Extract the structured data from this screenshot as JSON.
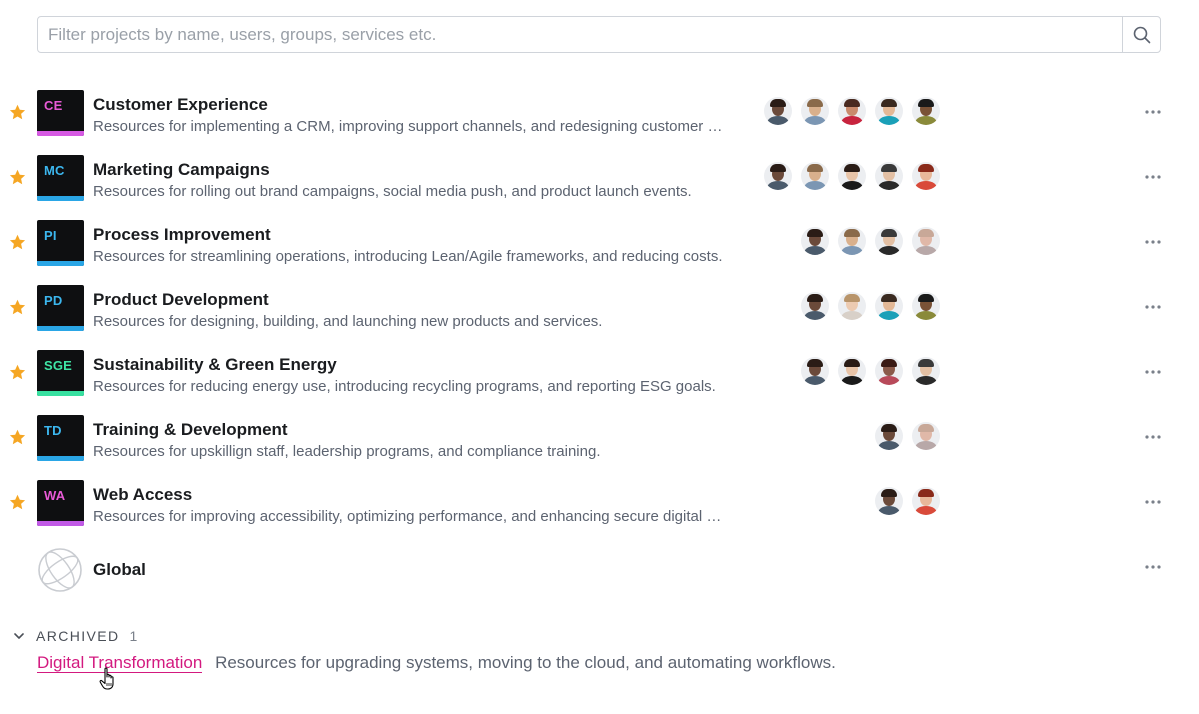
{
  "search": {
    "placeholder": "Filter projects by name, users, groups, services etc."
  },
  "projects": [
    {
      "abbr": "CE",
      "abbr_color": "#e85ad6",
      "stripe": "#d65ae3",
      "title": "Customer Experience",
      "desc": "Resources for implementing a CRM, improving support channels, and redesigning customer to...",
      "starred": true,
      "avatars": [
        {
          "skin": "#6b4a3a",
          "hair": "#2a1c16",
          "shirt": "#4a5a6b"
        },
        {
          "skin": "#d9b08c",
          "hair": "#8a6a4a",
          "shirt": "#7b96b3"
        },
        {
          "skin": "#c98a6c",
          "hair": "#4a2a20",
          "shirt": "#c8243e"
        },
        {
          "skin": "#e3b896",
          "hair": "#3a2a20",
          "shirt": "#1aa0b8"
        },
        {
          "skin": "#7a5236",
          "hair": "#1a1a1a",
          "shirt": "#8a8a3a"
        }
      ]
    },
    {
      "abbr": "MC",
      "abbr_color": "#3cb7ef",
      "stripe": "#2aa6e6",
      "title": "Marketing Campaigns",
      "desc": "Resources for rolling out brand campaigns, social media push, and product launch events.",
      "starred": true,
      "avatars": [
        {
          "skin": "#6b4a3a",
          "hair": "#2a1c16",
          "shirt": "#4a5a6b"
        },
        {
          "skin": "#d9b08c",
          "hair": "#8a6a4a",
          "shirt": "#7b96b3"
        },
        {
          "skin": "#e8c4a8",
          "hair": "#2a1c16",
          "shirt": "#1a1a1a"
        },
        {
          "skin": "#e3c0a4",
          "hair": "#3a3a3a",
          "shirt": "#2a2a2a"
        },
        {
          "skin": "#e8b89a",
          "hair": "#8a2a1a",
          "shirt": "#d94a3a"
        }
      ]
    },
    {
      "abbr": "PI",
      "abbr_color": "#3cb7ef",
      "stripe": "#2aa6e6",
      "title": "Process Improvement",
      "desc": "Resources for streamlining operations, introducing Lean/Agile frameworks, and reducing costs.",
      "starred": true,
      "avatars": [
        {
          "skin": "#6b4a3a",
          "hair": "#2a1c16",
          "shirt": "#4a5a6b"
        },
        {
          "skin": "#d9b08c",
          "hair": "#8a6a4a",
          "shirt": "#7b96b3"
        },
        {
          "skin": "#e3c0a4",
          "hair": "#3a3a3a",
          "shirt": "#2a2a2a"
        },
        {
          "skin": "#e0b8a8",
          "hair": "#c8a898",
          "shirt": "#b8a8a8"
        }
      ]
    },
    {
      "abbr": "PD",
      "abbr_color": "#3cb7ef",
      "stripe": "#2aa6e6",
      "title": "Product Development",
      "desc": "Resources for designing, building, and launching new products and services.",
      "starred": true,
      "avatars": [
        {
          "skin": "#6b4a3a",
          "hair": "#2a1c16",
          "shirt": "#4a5a6b"
        },
        {
          "skin": "#eccab0",
          "hair": "#b8946a",
          "shirt": "#d8d0c8"
        },
        {
          "skin": "#e3b896",
          "hair": "#3a2a20",
          "shirt": "#1aa0b8"
        },
        {
          "skin": "#7a5236",
          "hair": "#1a1a1a",
          "shirt": "#8a8a3a"
        }
      ]
    },
    {
      "abbr": "SGE",
      "abbr_color": "#3ee6a6",
      "stripe": "#38e0a0",
      "title": "Sustainability & Green Energy",
      "desc": "Resources for reducing energy use, introducing recycling programs, and reporting ESG goals.",
      "starred": true,
      "avatars": [
        {
          "skin": "#6b4a3a",
          "hair": "#2a1c16",
          "shirt": "#4a5a6b"
        },
        {
          "skin": "#e8c4a8",
          "hair": "#2a1c16",
          "shirt": "#1a1a1a"
        },
        {
          "skin": "#8a5a4a",
          "hair": "#3a1a14",
          "shirt": "#b84a5a"
        },
        {
          "skin": "#e3c0a4",
          "hair": "#3a3a3a",
          "shirt": "#2a2a2a"
        }
      ]
    },
    {
      "abbr": "TD",
      "abbr_color": "#3cb7ef",
      "stripe": "#2aa6e6",
      "title": "Training & Development",
      "desc": "Resources for upskillign staff, leadership programs, and compliance training.",
      "starred": true,
      "avatars": [
        {
          "skin": "#6b4a3a",
          "hair": "#2a1c16",
          "shirt": "#4a5a6b"
        },
        {
          "skin": "#e0b8a8",
          "hair": "#c8a898",
          "shirt": "#b8a8a8"
        }
      ]
    },
    {
      "abbr": "WA",
      "abbr_color": "#e85ad6",
      "stripe": "#c15ae6",
      "title": "Web Access",
      "desc": "Resources for improving accessibility, optimizing performance, and enhancing secure digital access for users.",
      "starred": true,
      "avatars": [
        {
          "skin": "#6b4a3a",
          "hair": "#2a1c16",
          "shirt": "#4a5a6b"
        },
        {
          "skin": "#e8b89a",
          "hair": "#8a2a1a",
          "shirt": "#d94a3a"
        }
      ]
    }
  ],
  "global": {
    "title": "Global"
  },
  "archived": {
    "label": "ARCHIVED",
    "count": "1",
    "item": {
      "title": "Digital Transformation",
      "desc": "Resources for upgrading systems, moving to the cloud, and automating workflows."
    }
  },
  "colors": {
    "star": "#f5a623",
    "link": "#d3197f",
    "logo_bg": "#0e0f11"
  }
}
